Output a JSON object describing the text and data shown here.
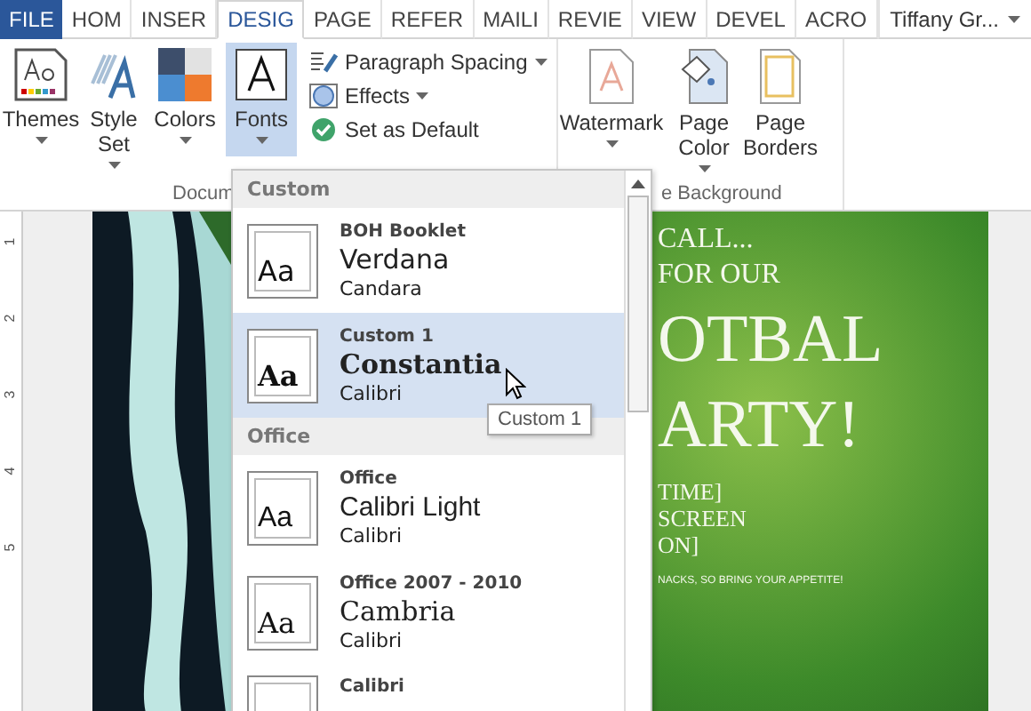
{
  "tabs": [
    {
      "label": "FILE",
      "kind": "file",
      "selected": false
    },
    {
      "label": "HOM",
      "kind": "tab",
      "selected": false
    },
    {
      "label": "INSER",
      "kind": "tab",
      "selected": false
    },
    {
      "label": "DESIG",
      "kind": "tab",
      "selected": true
    },
    {
      "label": "PAGE",
      "kind": "tab",
      "selected": false
    },
    {
      "label": "REFER",
      "kind": "tab",
      "selected": false
    },
    {
      "label": "MAILI",
      "kind": "tab",
      "selected": false
    },
    {
      "label": "REVIE",
      "kind": "tab",
      "selected": false
    },
    {
      "label": "VIEW",
      "kind": "tab",
      "selected": false
    },
    {
      "label": "DEVEL",
      "kind": "tab",
      "selected": false
    },
    {
      "label": "ACRO",
      "kind": "tab",
      "selected": false
    }
  ],
  "user": {
    "name": "Tiffany Gr...",
    "dropdown": true
  },
  "ribbon": {
    "document_formatting": {
      "label": "Docum",
      "large_buttons": [
        {
          "label": "Themes",
          "kind": "themes",
          "dropdown": true,
          "selected": false
        },
        {
          "label": "Style Set",
          "kind": "style",
          "dropdown": true,
          "selected": false
        },
        {
          "label": "Colors",
          "kind": "colors",
          "dropdown": true,
          "selected": false
        },
        {
          "label": "Fonts",
          "kind": "fonts",
          "dropdown": true,
          "selected": true
        }
      ],
      "small_buttons": [
        {
          "label": "Paragraph Spacing",
          "kind": "spacing",
          "dropdown": true
        },
        {
          "label": "Effects",
          "kind": "effects",
          "dropdown": true
        },
        {
          "label": "Set as Default",
          "kind": "default",
          "dropdown": false
        }
      ]
    },
    "page_background": {
      "label": "e Background",
      "buttons": [
        {
          "label": "Watermark",
          "kind": "watermark",
          "dropdown": true
        },
        {
          "label": "Page Color",
          "kind": "pagecolor",
          "dropdown": true
        },
        {
          "label": "Page Borders",
          "kind": "borders"
        }
      ]
    }
  },
  "ruler": [
    "1",
    "2",
    "3",
    "4",
    "5"
  ],
  "flyer": {
    "lines": [
      "CALL...",
      "FOR OUR"
    ],
    "title": [
      "OTBAL",
      "ARTY!"
    ],
    "details": [
      "TIME]",
      "SCREEN",
      "ON]"
    ],
    "note": "NACKS, SO BRING YOUR APPETITE!"
  },
  "fonts_menu": {
    "sections": [
      {
        "heading": "Custom",
        "items": [
          {
            "name": "BOH Booklet",
            "sample": "Aa",
            "heading_font": "Verdana",
            "kind": "sans",
            "body_font": "Candara",
            "selected": false
          },
          {
            "name": "Custom 1",
            "sample": "Aa",
            "heading_font": "Constantia",
            "kind": "serif",
            "body_font": "Calibri",
            "selected": true
          }
        ]
      },
      {
        "heading": "Office",
        "items": [
          {
            "name": "Office",
            "sample": "Aa",
            "heading_font": "Calibri Light",
            "kind": "light",
            "body_font": "Calibri",
            "selected": false
          },
          {
            "name": "Office 2007 - 2010",
            "sample": "Aa",
            "heading_font": "Cambria",
            "kind": "plainserif",
            "body_font": "Calibri",
            "selected": false
          },
          {
            "name": "Calibri",
            "selected": false
          }
        ]
      }
    ],
    "tooltip": "Custom 1"
  }
}
